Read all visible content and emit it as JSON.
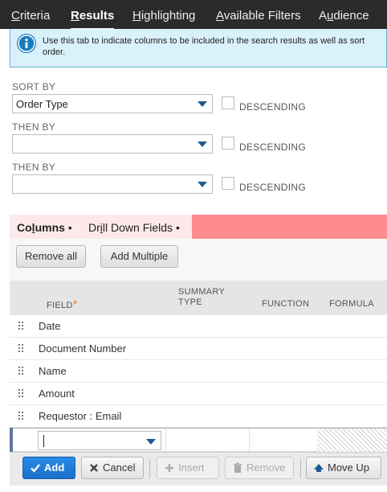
{
  "tabs": [
    {
      "pre": "",
      "key": "C",
      "post": "riteria"
    },
    {
      "pre": "",
      "key": "R",
      "post": "esults"
    },
    {
      "pre": "",
      "key": "H",
      "post": "ighlighting"
    },
    {
      "pre": "",
      "key": "A",
      "post": "vailable Filters"
    },
    {
      "pre": "A",
      "key": "u",
      "post": "dience"
    }
  ],
  "active_tab": "Results",
  "info": {
    "icon": "info-icon",
    "text": "Use this tab to indicate columns to be included in the search results as well as sort order."
  },
  "sort": {
    "sort_by_label": "SORT BY",
    "sort_by_value": "Order Type",
    "then_by_label_1": "THEN BY",
    "then_by_value_1": "",
    "then_by_label_2": "THEN BY",
    "then_by_value_2": "",
    "descending_label": "DESCENDING"
  },
  "subtabs": [
    {
      "pre": "Co",
      "key": "l",
      "post": "umns",
      "dot": "•"
    },
    {
      "pre": "Dr",
      "key": "i",
      "post": "ll Down Fields",
      "dot": "•"
    }
  ],
  "buttons": {
    "remove_all": "Remove all",
    "add_multiple": "Add Multiple"
  },
  "table": {
    "headers": {
      "field": "FIELD",
      "required_mark": "*",
      "summary_type_line1": "SUMMARY",
      "summary_type_line2": "TYPE",
      "function": "FUNCTION",
      "formula": "FORMULA"
    },
    "rows": [
      "Date",
      "Document Number",
      "Name",
      "Amount",
      "Requestor : Email"
    ]
  },
  "actions": {
    "add": "Add",
    "cancel": "Cancel",
    "insert": "Insert",
    "remove": "Remove",
    "move_up": "Move Up"
  },
  "colors": {
    "topbar": "#2b2b2b",
    "primary": "#1a6fc9",
    "subtab_highlight": "#fe8c8f",
    "info_bg": "#d9f1fb"
  }
}
